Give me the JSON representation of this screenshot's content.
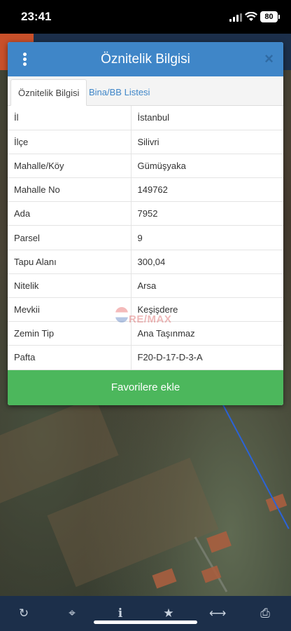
{
  "status_bar": {
    "time": "23:41",
    "battery": "80"
  },
  "modal": {
    "title": "Öznitelik Bilgisi",
    "close_label": "×",
    "tabs": [
      {
        "label": "Öznitelik Bilgisi",
        "active": true
      },
      {
        "label": "Bina/BB Listesi",
        "active": false
      }
    ],
    "rows": [
      {
        "key": "İl",
        "value": "İstanbul"
      },
      {
        "key": "İlçe",
        "value": "Silivri"
      },
      {
        "key": "Mahalle/Köy",
        "value": "Gümüşyaka"
      },
      {
        "key": "Mahalle No",
        "value": "149762"
      },
      {
        "key": "Ada",
        "value": "7952"
      },
      {
        "key": "Parsel",
        "value": "9"
      },
      {
        "key": "Tapu Alanı",
        "value": "300,04"
      },
      {
        "key": "Nitelik",
        "value": "Arsa"
      },
      {
        "key": "Mevkii",
        "value": "Keşişdere"
      },
      {
        "key": "Zemin Tip",
        "value": "Ana Taşınmaz"
      },
      {
        "key": "Pafta",
        "value": "F20-D-17-D-3-A"
      }
    ],
    "favorite_button": "Favorilere ekle"
  },
  "watermark": {
    "text": "RE/MAX"
  },
  "toolbar": {
    "icons": [
      "refresh-icon",
      "crosshair-icon",
      "info-icon",
      "star-icon",
      "measure-icon",
      "print-icon"
    ]
  },
  "colors": {
    "header": "#3f86c8",
    "favorite": "#4cb75c",
    "toolbar": "#1c2f4a"
  }
}
